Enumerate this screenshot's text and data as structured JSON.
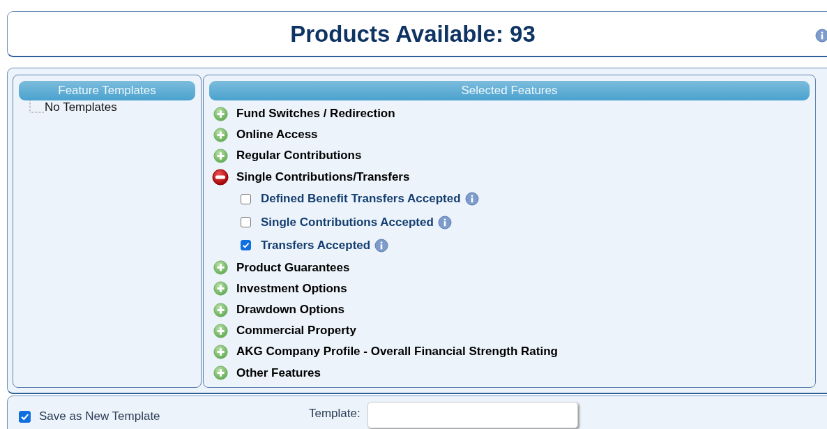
{
  "header": {
    "title": "Products Available: 93"
  },
  "templates": {
    "title": "Feature Templates",
    "items": [
      "No Templates"
    ]
  },
  "features": {
    "title": "Selected Features",
    "groups": [
      {
        "label": "Fund Switches / Redirection",
        "expanded": false
      },
      {
        "label": "Online Access",
        "expanded": false
      },
      {
        "label": "Regular Contributions",
        "expanded": false
      },
      {
        "label": "Single Contributions/Transfers",
        "expanded": true,
        "children": [
          {
            "label": "Defined Benefit Transfers Accepted",
            "checked": false
          },
          {
            "label": "Single Contributions Accepted",
            "checked": false
          },
          {
            "label": "Transfers Accepted",
            "checked": true
          }
        ]
      },
      {
        "label": "Product Guarantees",
        "expanded": false
      },
      {
        "label": "Investment Options",
        "expanded": false
      },
      {
        "label": "Drawdown Options",
        "expanded": false
      },
      {
        "label": "Commercial Property",
        "expanded": false
      },
      {
        "label": "AKG Company Profile - Overall Financial Strength Rating",
        "expanded": false
      },
      {
        "label": "Other Features",
        "expanded": false
      }
    ]
  },
  "footer": {
    "save_as_new": {
      "label": "Save as New Template",
      "checked": true
    },
    "template_label": "Template:"
  }
}
